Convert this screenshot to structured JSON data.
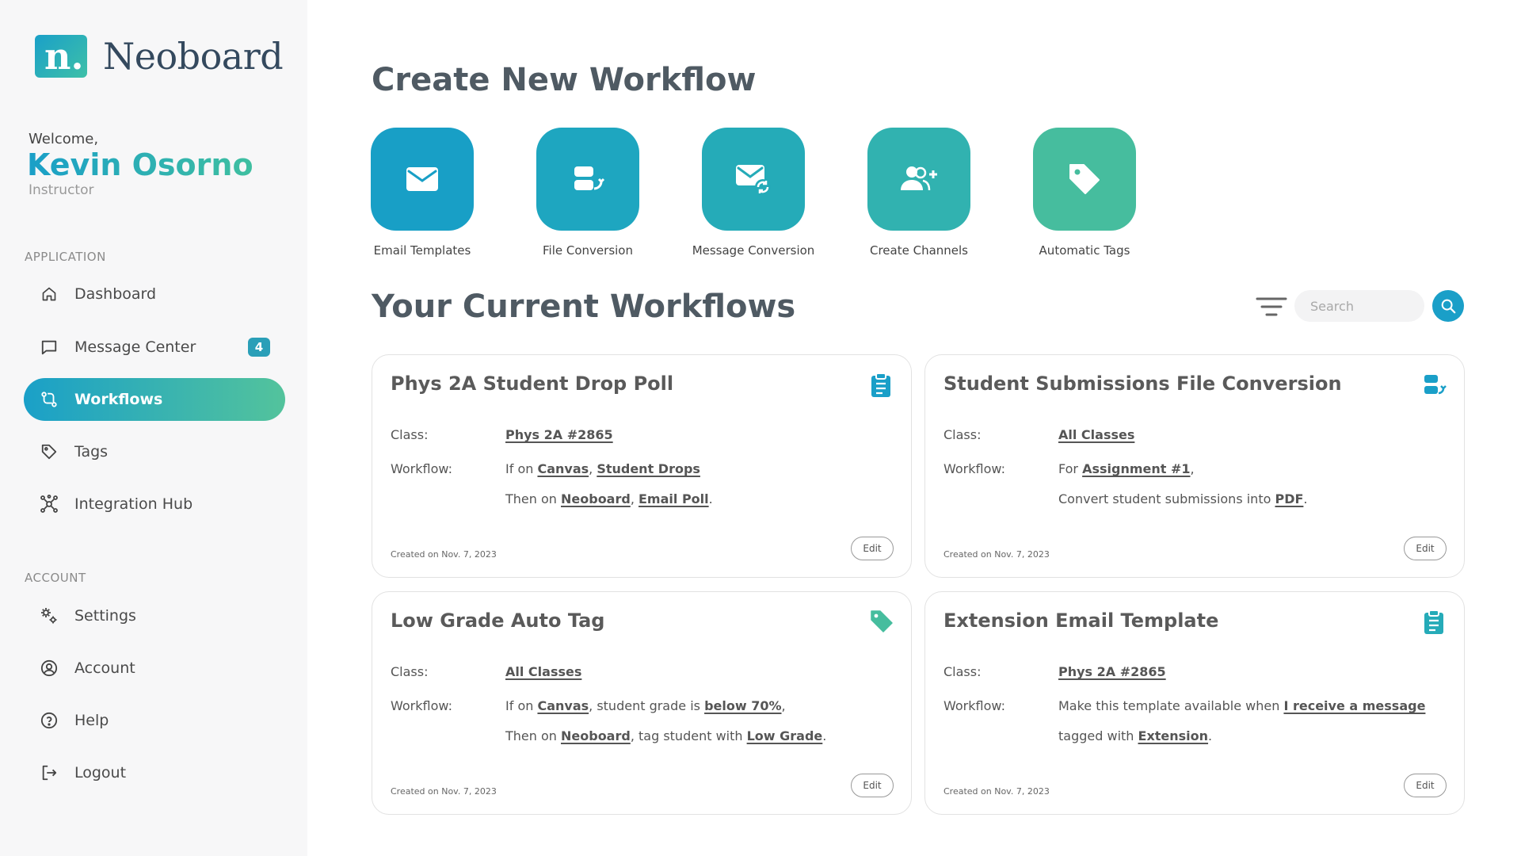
{
  "brand": {
    "name": "Neoboard",
    "mark": "n."
  },
  "user": {
    "welcome": "Welcome,",
    "name": "Kevin Osorno",
    "role": "Instructor"
  },
  "sidebar": {
    "application_label": "APPLICATION",
    "account_label": "ACCOUNT",
    "items": [
      {
        "label": "Dashboard",
        "icon": "home-icon"
      },
      {
        "label": "Message Center",
        "icon": "chat-icon",
        "badge": "4"
      },
      {
        "label": "Workflows",
        "icon": "workflow-icon",
        "active": true
      },
      {
        "label": "Tags",
        "icon": "tag-icon"
      },
      {
        "label": "Integration Hub",
        "icon": "hub-icon"
      }
    ],
    "account_items": [
      {
        "label": "Settings",
        "icon": "gear-icon"
      },
      {
        "label": "Account",
        "icon": "user-circle-icon"
      },
      {
        "label": "Help",
        "icon": "help-icon"
      },
      {
        "label": "Logout",
        "icon": "logout-icon"
      }
    ]
  },
  "create": {
    "title": "Create New Workflow",
    "actions": [
      {
        "label": "Email Templates",
        "icon": "mail-icon",
        "color": "#189fc6"
      },
      {
        "label": "File Conversion",
        "icon": "file-convert-icon",
        "color": "#1ea6c0"
      },
      {
        "label": "Message Conversion",
        "icon": "mail-sync-icon",
        "color": "#25abb8"
      },
      {
        "label": "Create Channels",
        "icon": "add-users-icon",
        "color": "#31b2b0"
      },
      {
        "label": "Automatic Tags",
        "icon": "tag-icon",
        "color": "#46bd9e"
      }
    ]
  },
  "current": {
    "title": "Your Current Workflows",
    "search_placeholder": "Search",
    "class_key": "Class:",
    "workflow_key": "Workflow:",
    "edit_label": "Edit",
    "cards": [
      {
        "title": "Phys 2A Student Drop Poll",
        "icon": "clipboard-icon",
        "class": "Phys 2A #2865",
        "line1": {
          "a": "If on ",
          "b": "Canvas",
          "c": ", ",
          "d": "Student Drops",
          "e": ""
        },
        "line2": {
          "a": "Then on ",
          "b": "Neoboard",
          "c": ", ",
          "d": "Email Poll",
          "e": "."
        },
        "created": "Created on Nov. 7, 2023"
      },
      {
        "title": "Student Submissions File Conversion",
        "icon": "file-convert-icon",
        "class": "All Classes",
        "line1": {
          "a": "For ",
          "b": "Assignment #1",
          "c": ",",
          "d": "",
          "e": ""
        },
        "line2": {
          "a": "Convert student submissions into ",
          "b": "PDF",
          "c": ".",
          "d": "",
          "e": ""
        },
        "created": "Created on Nov. 7, 2023"
      },
      {
        "title": "Low Grade Auto Tag",
        "icon": "tag-icon",
        "class": "All Classes",
        "line1": {
          "a": "If on ",
          "b": "Canvas",
          "c": ", student grade is ",
          "d": "below 70%",
          "e": ","
        },
        "line2": {
          "a": "Then on ",
          "b": "Neoboard",
          "c": ", tag student with ",
          "d": "Low Grade",
          "e": "."
        },
        "created": "Created on Nov. 7, 2023"
      },
      {
        "title": "Extension Email Template",
        "icon": "clipboard-icon",
        "class": "Phys 2A #2865",
        "line1": {
          "a": "Make this template available when ",
          "b": "I receive a message",
          "c": "",
          "d": "",
          "e": ""
        },
        "line2": {
          "a": "tagged with ",
          "b": "Extension",
          "c": ".",
          "d": "",
          "e": ""
        },
        "created": "Created on Nov. 7, 2023"
      }
    ]
  },
  "colors": {
    "accent": "#1a9fc8",
    "accent2": "#3fbfa0",
    "text": "#4f5a63"
  }
}
